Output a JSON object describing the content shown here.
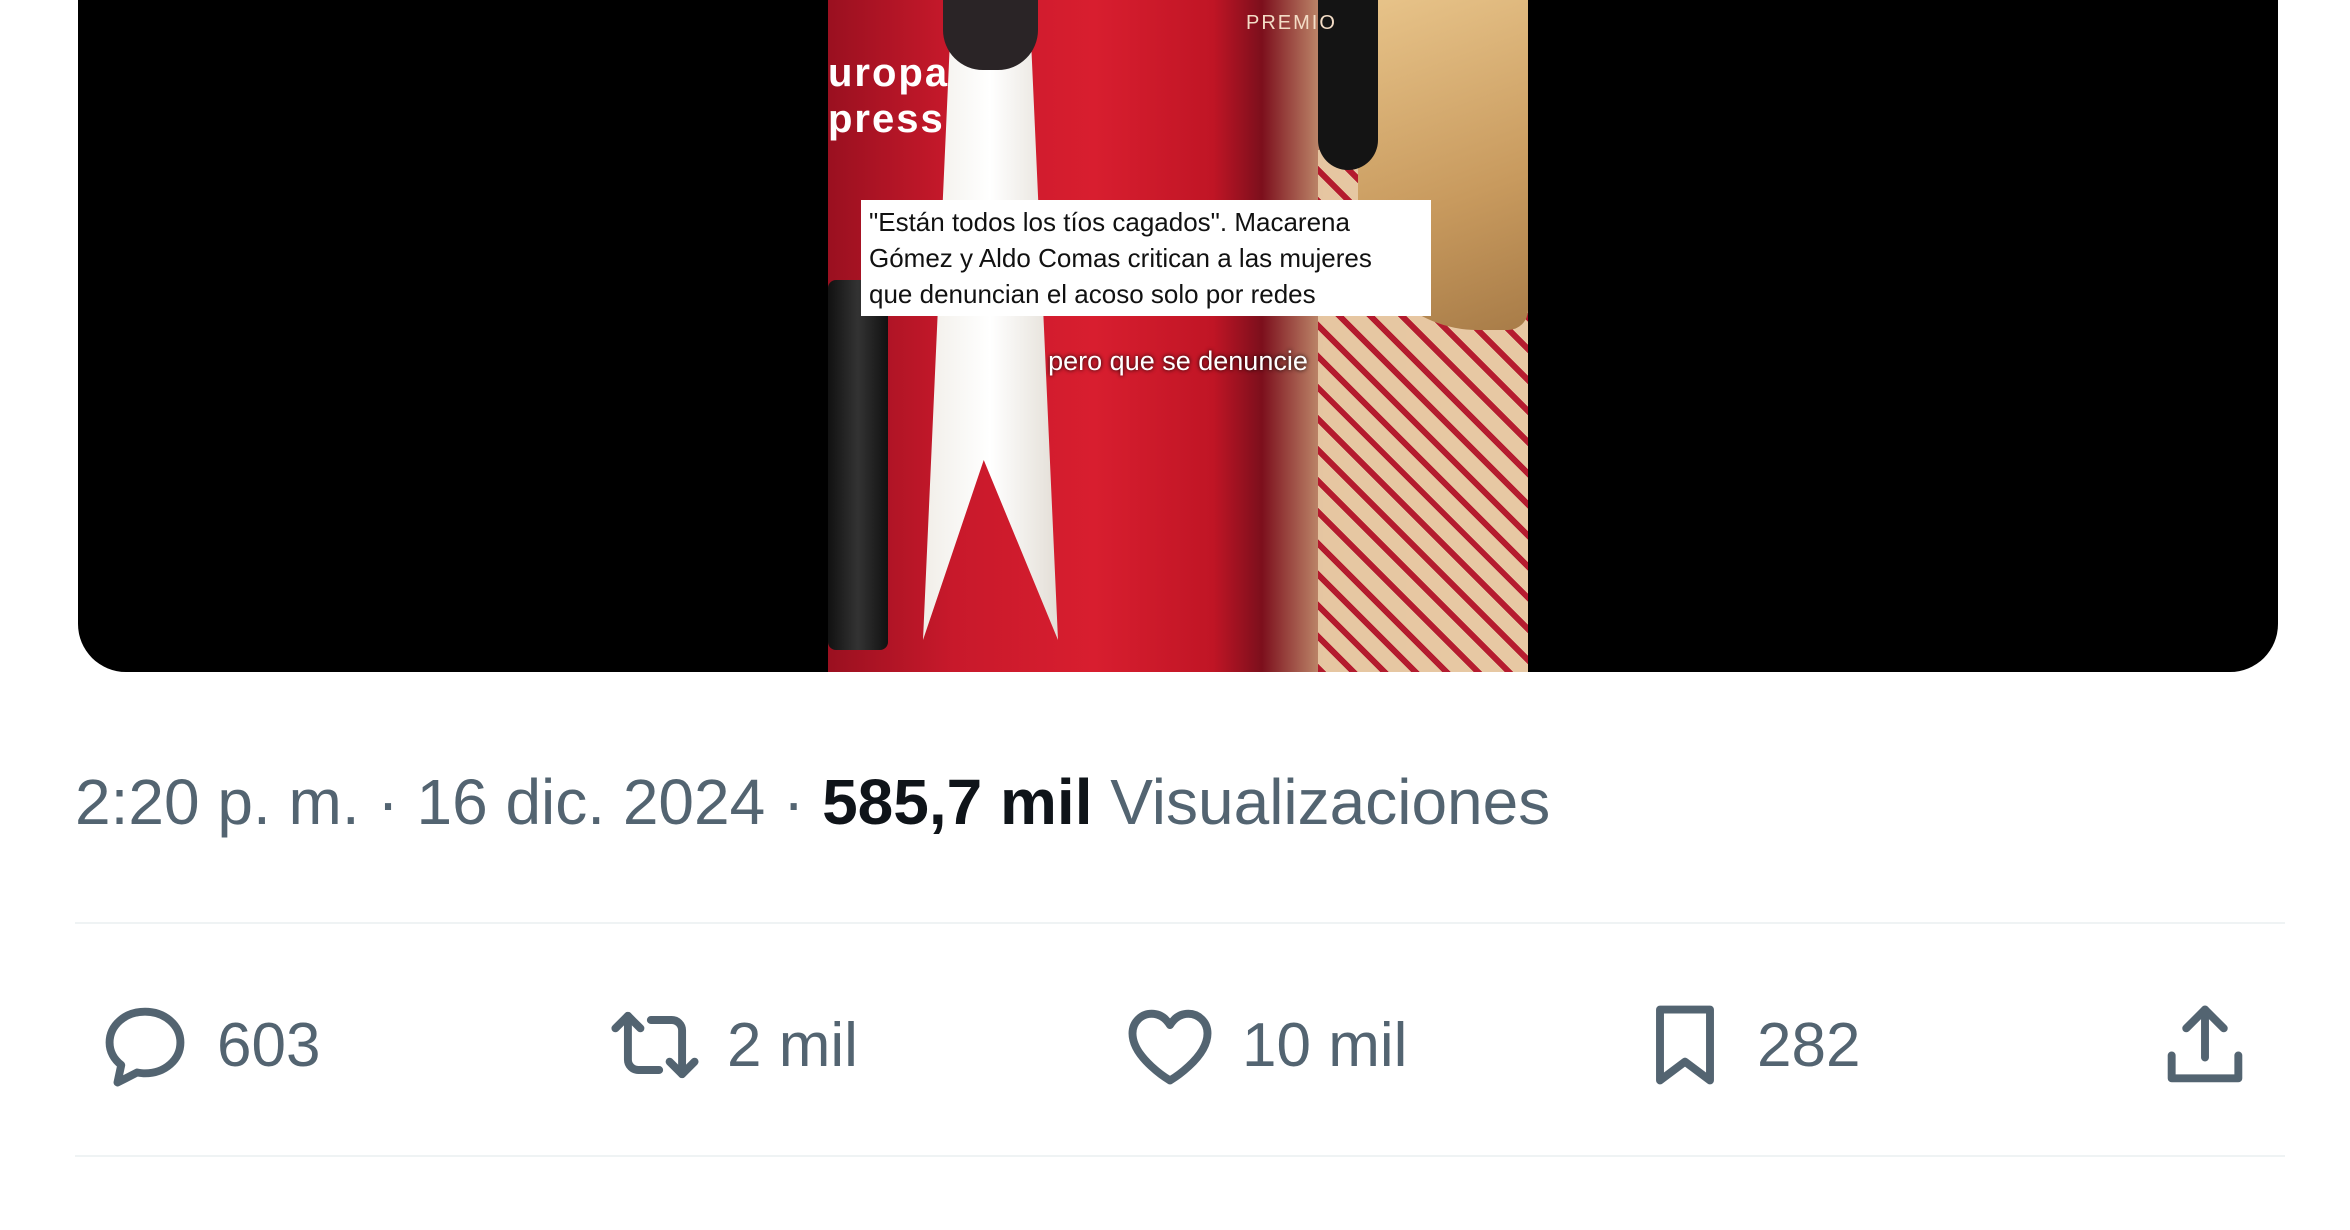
{
  "media": {
    "brand_line1": "uropa",
    "brand_line2": "press",
    "watermark": "PREMIO",
    "headline_line1": "\"Están todos los tíos cagados\". Macarena",
    "headline_line2": "Gómez y Aldo Comas critican a las mujeres",
    "headline_line3": "que denuncian el acoso solo por redes",
    "subtitle": "pero que se denuncie"
  },
  "meta": {
    "time": "2:20 p. m.",
    "separator": "·",
    "date": "16 dic. 2024",
    "views_count": "585,7 mil",
    "views_label": "Visualizaciones"
  },
  "actions": {
    "replies": "603",
    "reposts": "2 mil",
    "likes": "10 mil",
    "bookmarks": "282"
  },
  "icons": [
    "reply-icon",
    "repost-icon",
    "like-icon",
    "bookmark-icon",
    "share-icon"
  ],
  "colors": {
    "text_secondary": "#536471",
    "text_primary": "#0f1419",
    "divider": "#eff3f4"
  }
}
